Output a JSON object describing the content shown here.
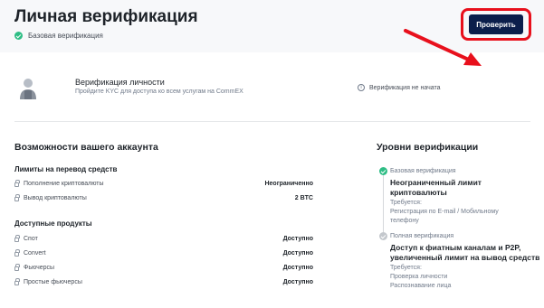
{
  "header": {
    "title": "Личная верификация",
    "base_status": "Базовая верификация"
  },
  "verify_card": {
    "title": "Верификация личности",
    "subtitle": "Пройдите KYC для доступа ко всем услугам на CommEX",
    "status": "Верификация не начата",
    "button_label": "Проверить"
  },
  "capabilities": {
    "title": "Возможности вашего аккаунта",
    "limits": {
      "title": "Лимиты на перевод средств",
      "rows": [
        {
          "label": "Пополнение криптовалюты",
          "value": "Неограниченно"
        },
        {
          "label": "Вывод криптовалюты",
          "value": "2 BTC"
        }
      ]
    },
    "products": {
      "title": "Доступные продукты",
      "rows": [
        {
          "label": "Спот",
          "value": "Доступно"
        },
        {
          "label": "Convert",
          "value": "Доступно"
        },
        {
          "label": "Фьючерсы",
          "value": "Доступно"
        },
        {
          "label": "Простые фьючерсы",
          "value": "Доступно"
        }
      ]
    }
  },
  "levels": {
    "title": "Уровни верификации",
    "items": [
      {
        "name": "Базовая верификация",
        "headline_1": "Неограниченный лимит",
        "headline_2": "криптовалюты",
        "required": "Требуется:",
        "req_1": "Регистрация по E-mail / Мобильному",
        "req_2": "телефону"
      },
      {
        "name": "Полная верификация",
        "headline_1": "Доступ к фиатным каналам и P2P,",
        "headline_2": "увеличенный лимит на вывод средств",
        "required": "Требуется:",
        "req_1": "Проверка личности",
        "req_2": "Распознавание лица"
      }
    ]
  },
  "colors": {
    "accent_button": "#0b1e4b",
    "highlight": "#e8101c",
    "success": "#2ebd85"
  }
}
